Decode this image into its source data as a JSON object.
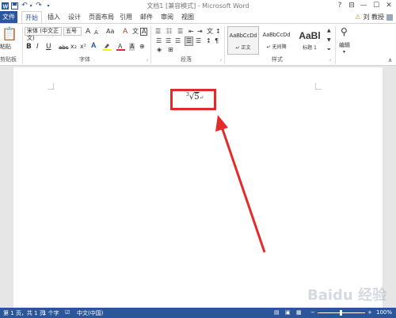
{
  "titlebar": {
    "title": "文档1 [兼容模式] - Microsoft Word",
    "help": "?",
    "ribbon_display": "⊟",
    "minimize": "—",
    "restore": "☐",
    "close": "✕"
  },
  "tabs": {
    "file": "文件",
    "items": [
      "开始",
      "插入",
      "设计",
      "页面布局",
      "引用",
      "邮件",
      "审阅",
      "视图"
    ],
    "user": "刘 教授"
  },
  "ribbon": {
    "clipboard": {
      "paste": "粘贴",
      "label": "剪贴板"
    },
    "font": {
      "name": "宋体 (中文正文)",
      "size": "五号",
      "grow": "A",
      "shrink": "A",
      "case": "Aa",
      "clear": "A",
      "wen": "文",
      "bold": "B",
      "italic": "I",
      "underline": "U",
      "strike": "abc",
      "subscript": "x₂",
      "superscript": "x²",
      "char_border": "A",
      "label": "字体"
    },
    "paragraph": {
      "label": "段落"
    },
    "styles": {
      "items": [
        {
          "sample": "AaBbCcDd",
          "name": "↵ 正文"
        },
        {
          "sample": "AaBbCcDd",
          "name": "↵ 无间隔"
        },
        {
          "sample": "AaBl",
          "name": "标题 1"
        }
      ],
      "label": "样式"
    },
    "editing": {
      "label": "编辑"
    }
  },
  "document": {
    "radical_index": "3",
    "radical_sign": "√",
    "radicand": "5",
    "paragraph_mark": "↵"
  },
  "statusbar": {
    "page": "第 1 页，共 1 页",
    "words": "1 个字",
    "language": "中文(中国)",
    "zoom": "100%",
    "zoom_minus": "−",
    "zoom_plus": "+"
  },
  "watermark": "Baidu 经验",
  "colors": {
    "accent": "#2b579a",
    "highlight_box": "#e32b2b",
    "arrow": "#e32b2b"
  }
}
